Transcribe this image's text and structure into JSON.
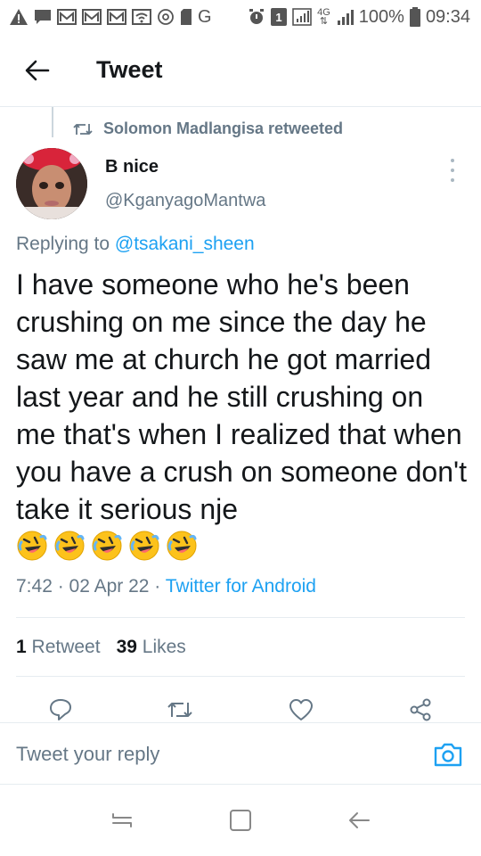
{
  "status_bar": {
    "battery_percent": "100%",
    "time": "09:34",
    "network": "4G",
    "sim": "1",
    "carrier_letter": "G"
  },
  "header": {
    "title": "Tweet"
  },
  "retweet_context": {
    "text": "Solomon Madlangisa retweeted"
  },
  "tweet": {
    "author_name": "B nice",
    "author_handle": "@KganyagoMantwa",
    "replying_prefix": "Replying to ",
    "replying_to": "@tsakani_sheen",
    "text": "I have someone who he's been crushing on me since the day he saw me at church he got married last year and he still crushing on me that's when I realized that when you have a crush on someone don't take it serious nje",
    "time": "7:42 · 02 Apr 22 · ",
    "client": "Twitter for Android"
  },
  "stats": {
    "retweet_count": "1",
    "retweet_label": "Retweet",
    "like_count": "39",
    "like_label": "Likes"
  },
  "reply_bar": {
    "placeholder": "Tweet your reply"
  },
  "colors": {
    "accent": "#1da1f2",
    "secondary_text": "#657786",
    "divider": "#e6ecf0",
    "emoji_face": "#fcc21b"
  },
  "icons": {
    "back": "arrow-left-icon",
    "retweet": "retweet-icon",
    "more": "more-vertical-icon",
    "reply": "reply-icon",
    "like": "heart-icon",
    "share": "share-icon",
    "camera": "camera-icon",
    "emoji": "rolling-laughing-emoji"
  }
}
